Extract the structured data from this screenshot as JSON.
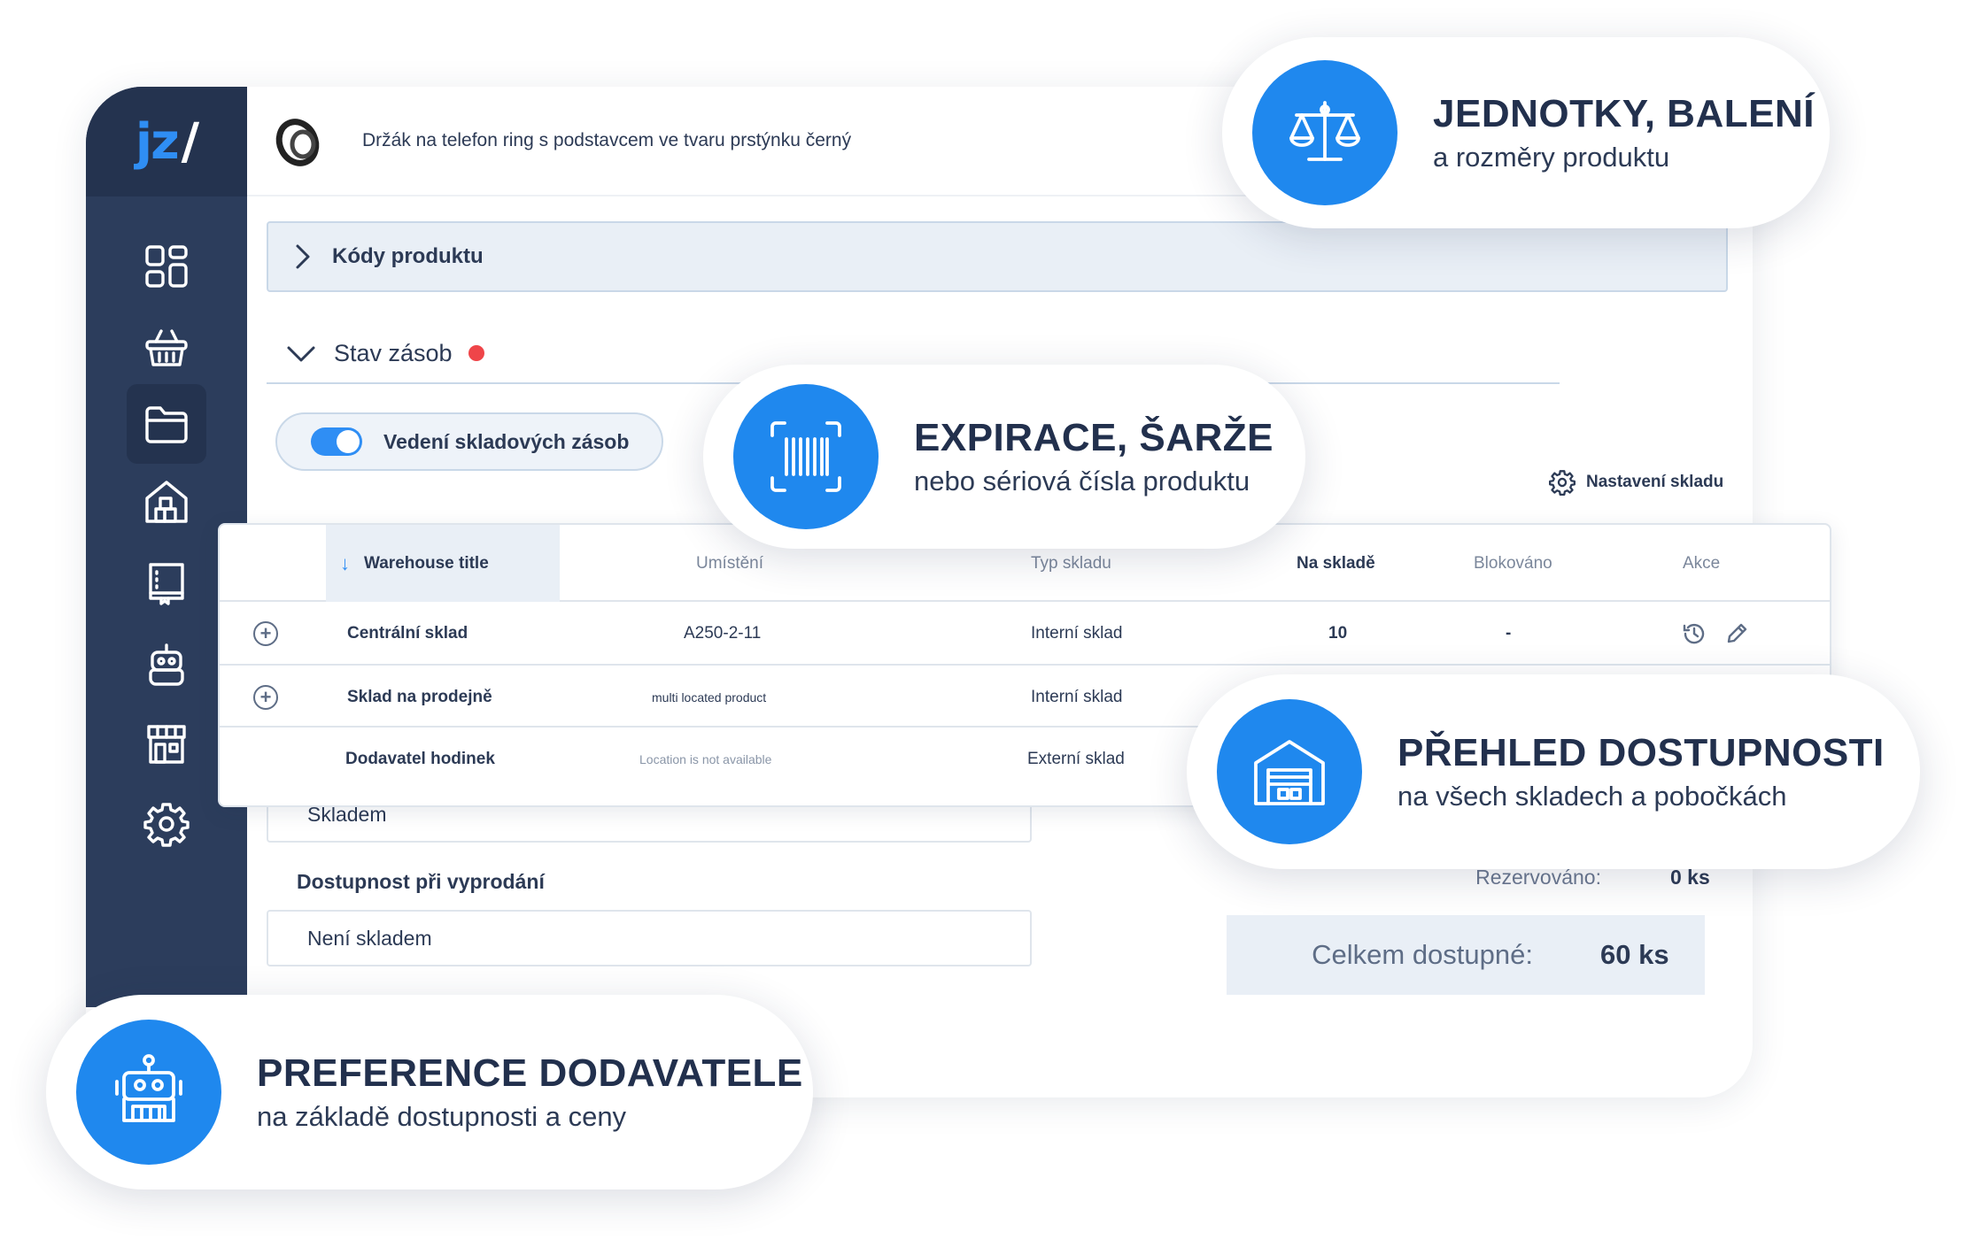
{
  "logo": {
    "text": "jz",
    "slash": "/"
  },
  "sidebar": {
    "items": [
      {
        "icon": "dashboard-icon"
      },
      {
        "icon": "basket-icon"
      },
      {
        "icon": "folder-icon",
        "active": true
      },
      {
        "icon": "warehouse-icon"
      },
      {
        "icon": "catalog-book-icon"
      },
      {
        "icon": "robot-icon"
      },
      {
        "icon": "store-icon"
      },
      {
        "icon": "gear-icon"
      }
    ]
  },
  "product": {
    "title": "Držák na telefon ring s podstavcem ve tvaru prstýnku černý"
  },
  "sections": {
    "codes": "Kódy produktu",
    "stock": "Stav zásob"
  },
  "toggle": {
    "label": "Vedení skladových zásob",
    "on": true
  },
  "warehouse_settings": "Nastavení skladu",
  "table": {
    "headers": {
      "title": "Warehouse title",
      "location": "Umístění",
      "type": "Typ skladu",
      "in_stock": "Na skladě",
      "blocked": "Blokováno",
      "actions": "Akce"
    },
    "rows": [
      {
        "name": "Centrální sklad",
        "location": "A250-2-11",
        "type": "Interní sklad",
        "in_stock": "10",
        "blocked": "-"
      },
      {
        "name": "Sklad na prodejně",
        "location": "multi located product",
        "type": "Interní sklad",
        "in_stock": "",
        "blocked": ""
      },
      {
        "name": "Dodavatel hodinek",
        "location": "Location is not available",
        "type": "Externí sklad",
        "in_stock": "",
        "blocked": ""
      }
    ]
  },
  "availability": {
    "in_stock_value": "Skladem",
    "sold_out_label": "Dostupnost při vyprodání",
    "sold_out_value": "Není skladem"
  },
  "summary": {
    "reserved_label": "Rezervováno:",
    "reserved_value": "0 ks",
    "total_label": "Celkem dostupné:",
    "total_value": "60 ks"
  },
  "callouts": [
    {
      "title": "JEDNOTKY, BALENÍ",
      "subtitle": "a rozměry produktu",
      "icon": "scale-icon"
    },
    {
      "title": "EXPIRACE, ŠARŽE",
      "subtitle": "nebo sériová čísla produktu",
      "icon": "barcode-scan-icon"
    },
    {
      "title": "PŘEHLED DOSTUPNOSTI",
      "subtitle": "na všech skladech a pobočkách",
      "icon": "warehouse-icon"
    },
    {
      "title": "PREFERENCE DODAVATELE",
      "subtitle": "na základě dostupnosti a ceny",
      "icon": "robot-icon"
    }
  ],
  "colors": {
    "accent": "#1f88ee",
    "sidebar": "#2c3d5c",
    "text": "#2c3a55",
    "alert": "#ef4549",
    "panel": "#e9eff6"
  }
}
